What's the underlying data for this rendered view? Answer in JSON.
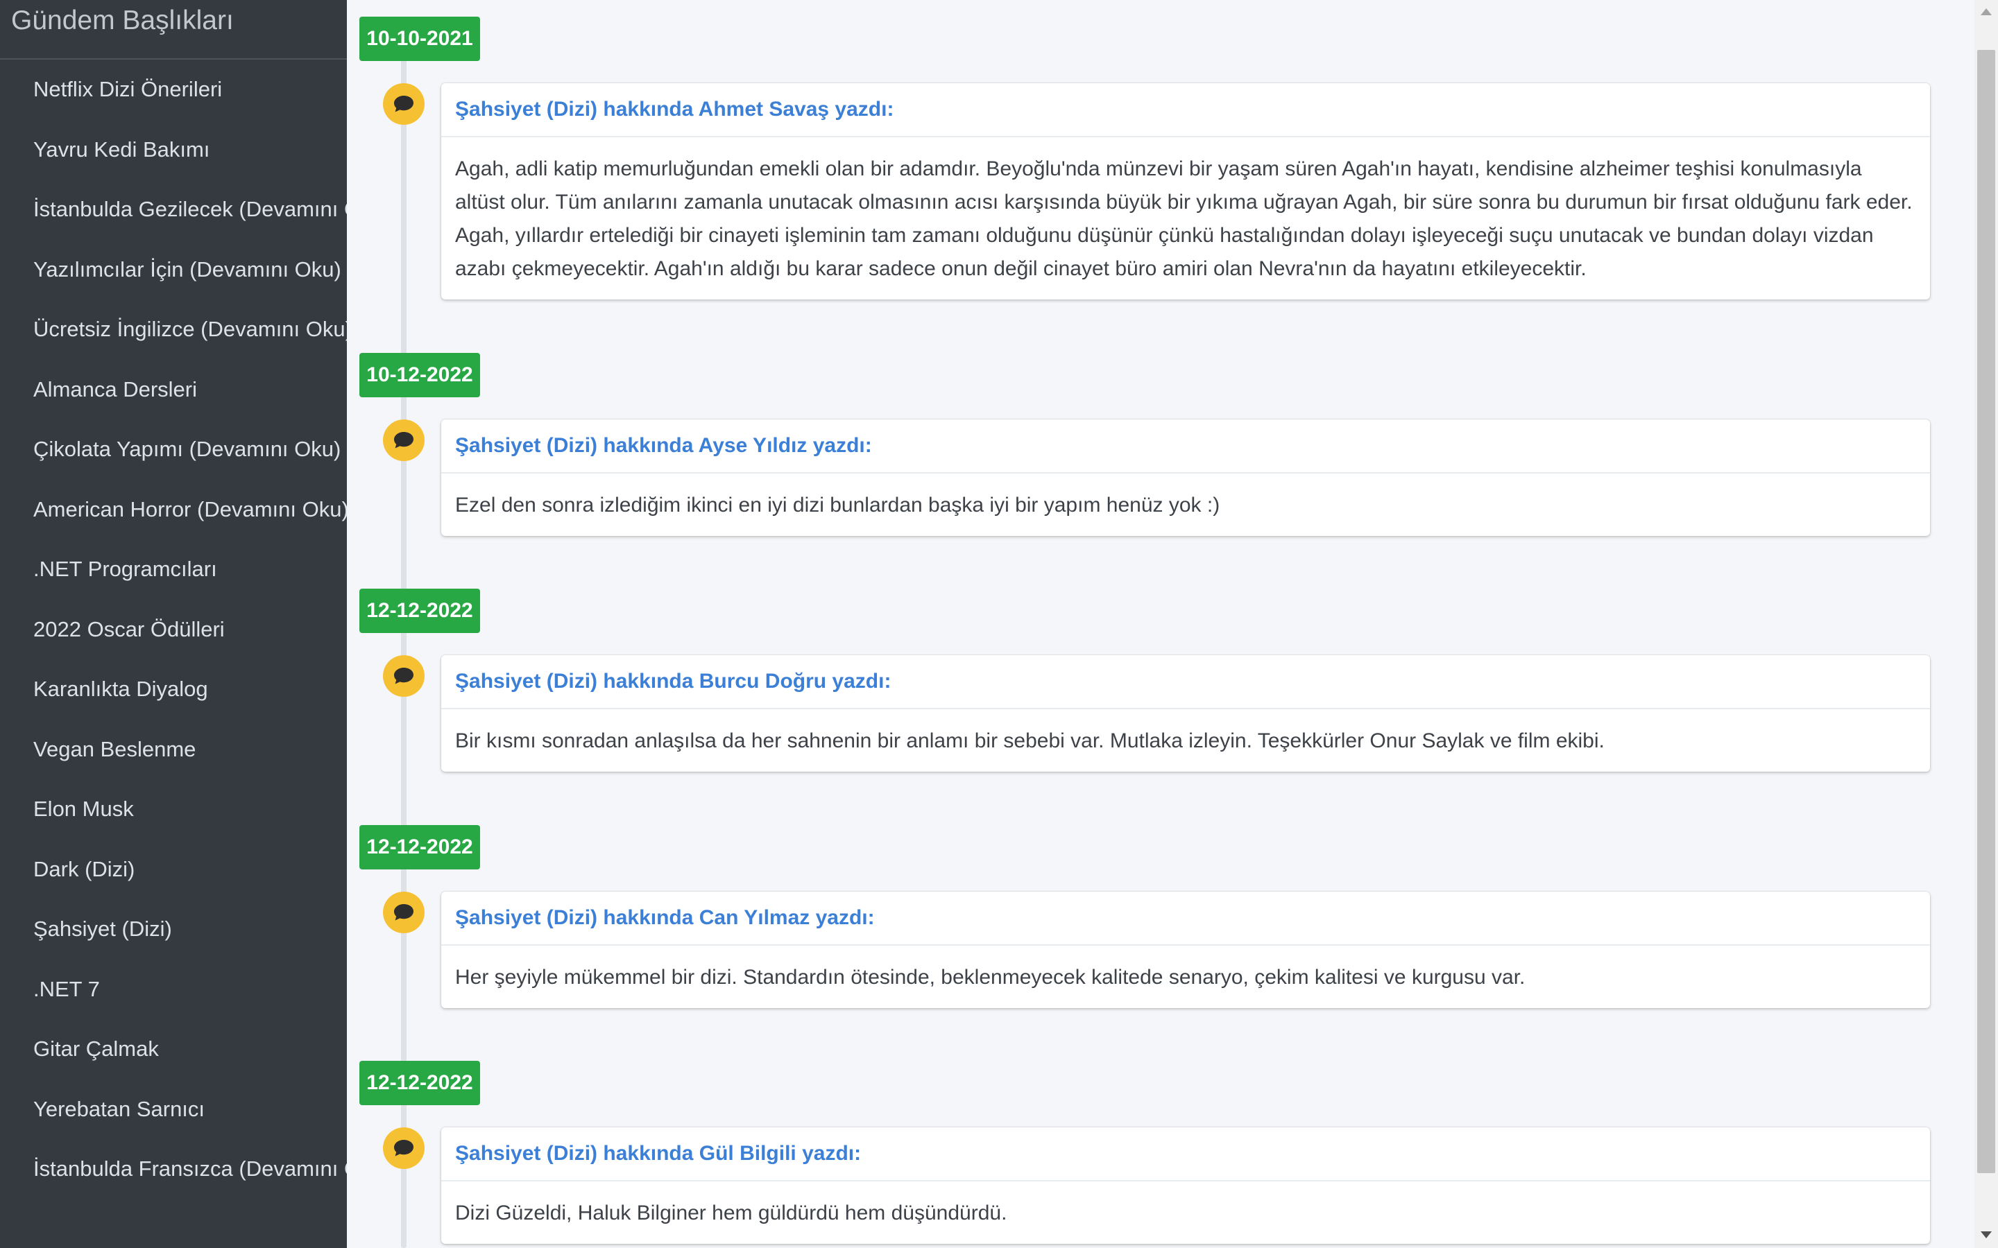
{
  "sidebar": {
    "title": "Gündem Başlıkları",
    "items": [
      "Netflix Dizi Önerileri",
      "Yavru Kedi Bakımı",
      "İstanbulda Gezilecek (Devamını Oku)",
      "Yazılımcılar İçin (Devamını Oku)",
      "Ücretsiz İngilizce (Devamını Oku)",
      "Almanca Dersleri",
      "Çikolata Yapımı (Devamını Oku)",
      "American Horror (Devamını Oku)",
      ".NET Programcıları",
      "2022 Oscar Ödülleri",
      "Karanlıkta Diyalog",
      "Vegan Beslenme",
      "Elon Musk",
      "Dark (Dizi)",
      "Şahsiyet (Dizi)",
      ".NET 7",
      "Gitar Çalmak",
      "Yerebatan Sarnıcı",
      "İstanbulda Fransızca (Devamını Oku)"
    ]
  },
  "timeline": [
    {
      "date": "10-10-2021",
      "header": "Şahsiyet (Dizi) hakkında Ahmet Savaş yazdı:",
      "body": "Agah, adli katip memurluğundan emekli olan bir adamdır. Beyoğlu'nda münzevi bir yaşam süren Agah'ın hayatı, kendisine alzheimer teşhisi konulmasıyla altüst olur. Tüm anılarını zamanla unutacak olmasının acısı karşısında büyük bir yıkıma uğrayan Agah, bir süre sonra bu durumun bir fırsat olduğunu fark eder. Agah, yıllardır ertelediği bir cinayeti işleminin tam zamanı olduğunu düşünür çünkü hastalığından dolayı işleyeceği suçu unutacak ve bundan dolayı vizdan azabı çekmeyecektir. Agah'ın aldığı bu karar sadece onun değil cinayet büro amiri olan Nevra'nın da hayatını etkileyecektir.",
      "icon": "comment-icon"
    },
    {
      "date": "10-12-2022",
      "header": "Şahsiyet (Dizi) hakkında Ayse Yıldız yazdı:",
      "body": "Ezel den sonra izlediğim ikinci en iyi dizi bunlardan başka iyi bir yapım henüz yok :)",
      "icon": "comment-icon"
    },
    {
      "date": "12-12-2022",
      "header": "Şahsiyet (Dizi) hakkında Burcu Doğru yazdı:",
      "body": "Bir kısmı sonradan anlaşılsa da her sahnenin bir anlamı bir sebebi var. Mutlaka izleyin. Teşekkürler Onur Saylak ve film ekibi.",
      "icon": "comment-icon"
    },
    {
      "date": "12-12-2022",
      "header": "Şahsiyet (Dizi) hakkında Can Yılmaz yazdı:",
      "body": "Her şeyiyle mükemmel bir dizi. Standardın ötesinde, beklenmeyecek kalitede senaryo, çekim kalitesi ve kurgusu var.",
      "icon": "comment-icon"
    },
    {
      "date": "12-12-2022",
      "header": "Şahsiyet (Dizi) hakkında Gül Bilgili yazdı:",
      "body": "Dizi Güzeldi, Haluk Bilginer hem güldürdü hem düşündürdü.",
      "icon": "comment-icon"
    }
  ],
  "colors": {
    "sidebar_bg": "#343a40",
    "date_badge": "#28a745",
    "icon_bg": "#f6c033",
    "header_link": "#3c7fd6"
  }
}
